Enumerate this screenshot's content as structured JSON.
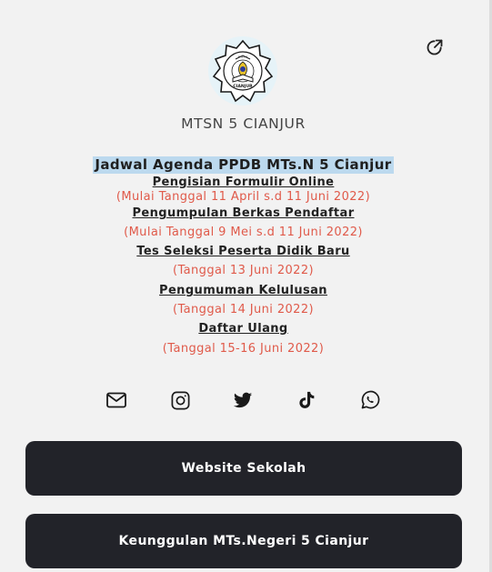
{
  "profile": {
    "name": "MTSN 5 CIANJUR",
    "logo_text": "MADRASAH TSANAWIYAH NEGERI 5 CIANJUR",
    "logo_bottom_text": "CIANJUR"
  },
  "header": {
    "share_icon": "share-arrow-icon"
  },
  "schedule": {
    "title": "Jadwal Agenda PPDB MTs.N 5 Cianjur",
    "items": [
      {
        "heading": "Pengisian Formulir Online",
        "date": "(Mulai Tanggal 11 April s.d 11 Juni 2022)"
      },
      {
        "heading": "Pengumpulan Berkas Pendaftar",
        "date": "(Mulai Tanggal 9 Mei s.d 11 Juni 2022)"
      },
      {
        "heading": "Tes Seleksi Peserta Didik Baru",
        "date": "(Tanggal 13 Juni 2022)"
      },
      {
        "heading": "Pengumuman Kelulusan",
        "date": "(Tanggal 14 Juni 2022)"
      },
      {
        "heading": "Daftar Ulang",
        "date": "(Tanggal 15-16 Juni 2022)"
      }
    ]
  },
  "socials": [
    {
      "icon": "email-icon"
    },
    {
      "icon": "instagram-icon"
    },
    {
      "icon": "twitter-icon"
    },
    {
      "icon": "tiktok-icon"
    },
    {
      "icon": "whatsapp-icon"
    }
  ],
  "links": [
    {
      "label": "Website Sekolah"
    },
    {
      "label": "Keunggulan MTs.Negeri 5 Cianjur"
    }
  ],
  "colors": {
    "title_highlight": "#bcd9ee",
    "date_text": "#e05a4a",
    "button_bg": "#222329"
  }
}
